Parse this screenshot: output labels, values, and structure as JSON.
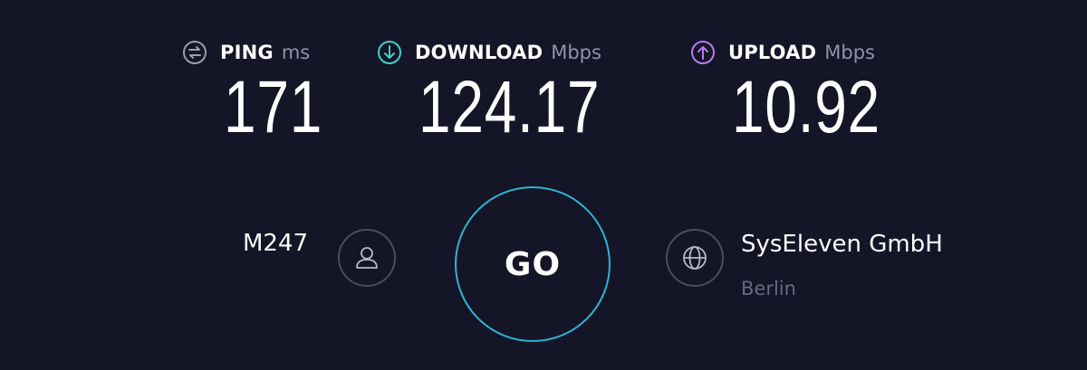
{
  "metrics": {
    "ping": {
      "label": "PING",
      "unit": "ms",
      "value": "171",
      "icon": "ping-icon",
      "color": "#9a9cae"
    },
    "download": {
      "label": "DOWNLOAD",
      "unit": "Mbps",
      "value": "124.17",
      "icon": "download-arrow-icon",
      "color": "#3ed0c6"
    },
    "upload": {
      "label": "UPLOAD",
      "unit": "Mbps",
      "value": "10.92",
      "icon": "upload-arrow-icon",
      "color": "#b77bf0"
    }
  },
  "provider": {
    "name": "M247",
    "icon": "user-icon"
  },
  "go_button": {
    "label": "GO",
    "color": "#2cb4d3"
  },
  "server": {
    "name": "SysEleven GmbH",
    "location": "Berlin",
    "icon": "globe-icon"
  },
  "colors": {
    "background": "#141526",
    "muted_text": "#676a80",
    "unit_text": "#9193a8"
  }
}
